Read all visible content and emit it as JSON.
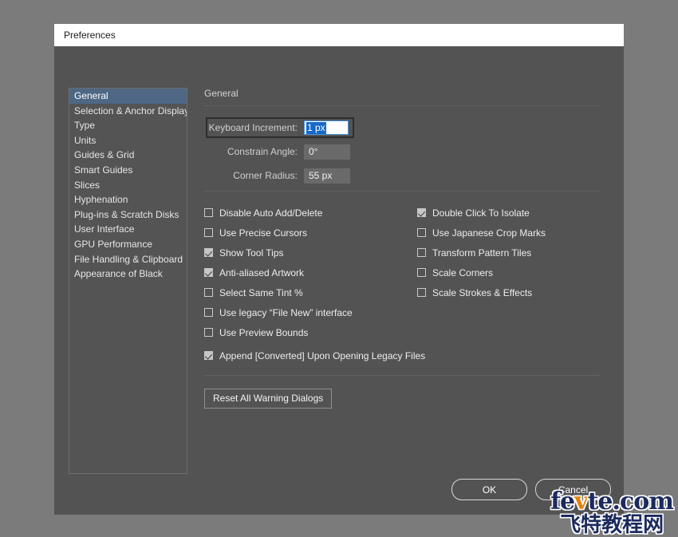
{
  "window": {
    "title": "Preferences"
  },
  "colors": {
    "desktop_background": "#7b7b7b",
    "dialog_background": "#535353",
    "titlebar_background": "#ffffff",
    "sidebar_selection": "#4e6785",
    "text_selection": "#1669c8",
    "accent_orange": "#e8820c",
    "watermark_navy": "#1b2a5e"
  },
  "sidebar": {
    "items": [
      {
        "label": "General",
        "selected": true
      },
      {
        "label": "Selection & Anchor Display",
        "selected": false
      },
      {
        "label": "Type",
        "selected": false
      },
      {
        "label": "Units",
        "selected": false
      },
      {
        "label": "Guides & Grid",
        "selected": false
      },
      {
        "label": "Smart Guides",
        "selected": false
      },
      {
        "label": "Slices",
        "selected": false
      },
      {
        "label": "Hyphenation",
        "selected": false
      },
      {
        "label": "Plug-ins & Scratch Disks",
        "selected": false
      },
      {
        "label": "User Interface",
        "selected": false
      },
      {
        "label": "GPU Performance",
        "selected": false
      },
      {
        "label": "File Handling & Clipboard",
        "selected": false
      },
      {
        "label": "Appearance of Black",
        "selected": false
      }
    ]
  },
  "content": {
    "section_title": "General",
    "fields": [
      {
        "label": "Keyboard Increment:",
        "value": "1 px",
        "focused": true,
        "selected_text": "1 px"
      },
      {
        "label": "Constrain Angle:",
        "value": "0°",
        "focused": false
      },
      {
        "label": "Corner Radius:",
        "value": "55 px",
        "focused": false
      }
    ],
    "checkboxes_left": [
      {
        "label": "Disable Auto Add/Delete",
        "checked": false
      },
      {
        "label": "Use Precise Cursors",
        "checked": false
      },
      {
        "label": "Show Tool Tips",
        "checked": true
      },
      {
        "label": "Anti-aliased Artwork",
        "checked": true
      },
      {
        "label": "Select Same Tint %",
        "checked": false
      },
      {
        "label": "Use legacy “File New” interface",
        "checked": false
      },
      {
        "label": "Use Preview Bounds",
        "checked": false
      }
    ],
    "checkboxes_right": [
      {
        "label": "Double Click To Isolate",
        "checked": true
      },
      {
        "label": "Use Japanese Crop Marks",
        "checked": false
      },
      {
        "label": "Transform Pattern Tiles",
        "checked": false
      },
      {
        "label": "Scale Corners",
        "checked": false
      },
      {
        "label": "Scale Strokes & Effects",
        "checked": false
      }
    ],
    "checkbox_wide": {
      "label": "Append [Converted] Upon Opening Legacy Files",
      "checked": true
    },
    "reset_button_label": "Reset All Warning Dialogs"
  },
  "footer": {
    "ok_label": "OK",
    "cancel_label": "Cancel"
  },
  "watermark": {
    "line1_a": "fe",
    "line1_v": "v",
    "line1_b": "te.com",
    "line2": "飞特教程网"
  }
}
